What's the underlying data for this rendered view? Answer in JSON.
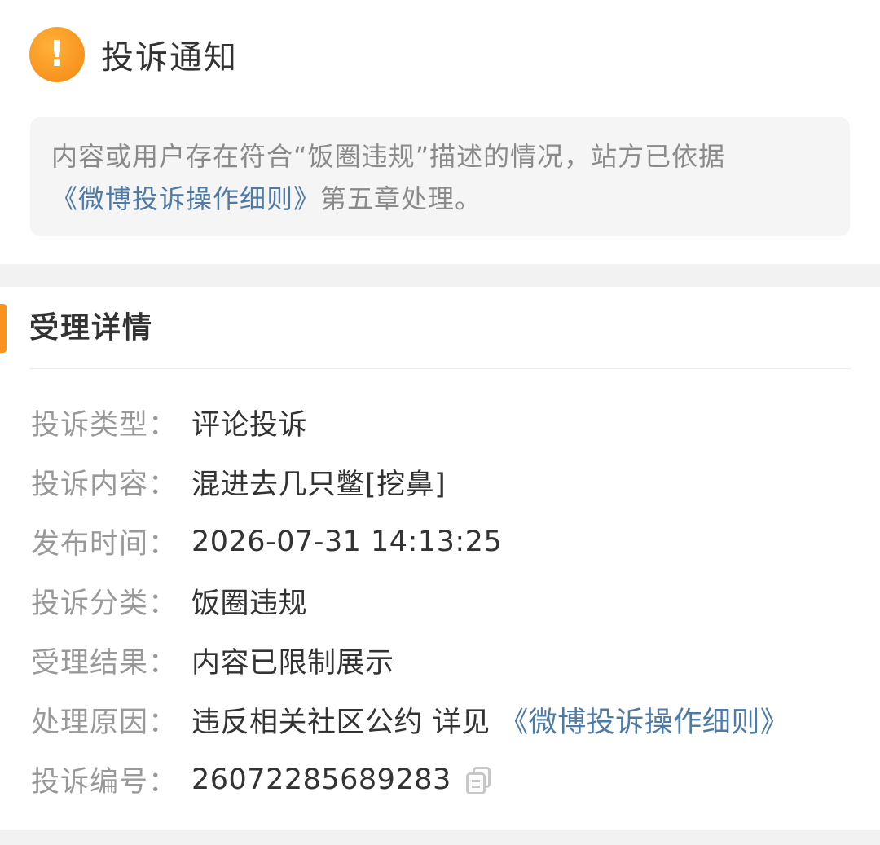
{
  "notice": {
    "icon": "warning-icon",
    "icon_glyph": "!",
    "title": "投诉通知",
    "text_prefix": "内容或用户存在符合“饭圈违规”描述的情况，站方已依据",
    "rule_link": "《微博投诉操作细则》",
    "text_suffix": "第五章处理。"
  },
  "details": {
    "section_title": "受理详情",
    "rows": [
      {
        "label": "投诉类型：",
        "value": "评论投诉"
      },
      {
        "label": "投诉内容：",
        "value": "混进去几只鳖[挖鼻]"
      },
      {
        "label": "发布时间：",
        "value": "2026-07-31 14:13:25"
      },
      {
        "label": "投诉分类：",
        "value": "饭圈违规"
      },
      {
        "label": "受理结果：",
        "value": "内容已限制展示"
      },
      {
        "label": "处理原因：",
        "value": "违反相关社区公约 详见",
        "link": "《微博投诉操作细则》"
      },
      {
        "label": "投诉编号：",
        "value": "26072285689283",
        "icon": "copy-icon"
      }
    ]
  },
  "colors": {
    "accent": "#f7931e",
    "link": "#4e7aa6",
    "label": "#999999",
    "value": "#333333"
  }
}
